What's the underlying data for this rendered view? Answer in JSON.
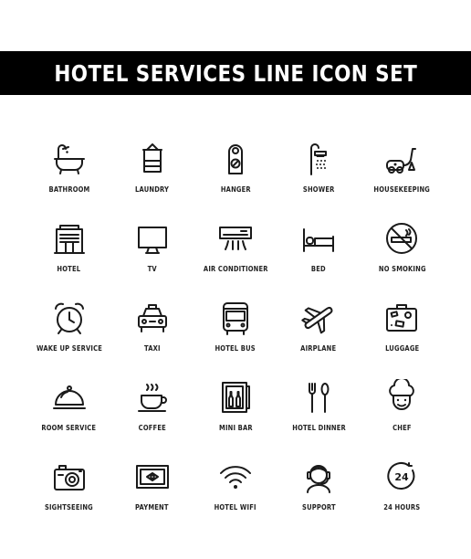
{
  "title": "HOTEL SERVICES LINE ICON SET",
  "icons": [
    {
      "label": "BATHROOM",
      "icon": "bathtub-icon"
    },
    {
      "label": "LAUNDRY",
      "icon": "towel-icon"
    },
    {
      "label": "HANGER",
      "icon": "door-hanger-icon"
    },
    {
      "label": "SHOWER",
      "icon": "shower-icon"
    },
    {
      "label": "HOUSEKEEPING",
      "icon": "vacuum-icon"
    },
    {
      "label": "HOTEL",
      "icon": "hotel-building-icon"
    },
    {
      "label": "TV",
      "icon": "tv-icon"
    },
    {
      "label": "AIR CONDITIONER",
      "icon": "air-conditioner-icon"
    },
    {
      "label": "BED",
      "icon": "bed-icon"
    },
    {
      "label": "NO SMOKING",
      "icon": "no-smoking-icon"
    },
    {
      "label": "WAKE UP SERVICE",
      "icon": "alarm-clock-icon"
    },
    {
      "label": "TAXI",
      "icon": "taxi-icon"
    },
    {
      "label": "HOTEL BUS",
      "icon": "bus-icon"
    },
    {
      "label": "AIRPLANE",
      "icon": "airplane-icon"
    },
    {
      "label": "LUGGAGE",
      "icon": "luggage-icon"
    },
    {
      "label": "ROOM SERVICE",
      "icon": "cloche-icon"
    },
    {
      "label": "COFFEE",
      "icon": "coffee-cup-icon"
    },
    {
      "label": "MINI BAR",
      "icon": "minibar-icon"
    },
    {
      "label": "HOTEL DINNER",
      "icon": "fork-spoon-icon"
    },
    {
      "label": "CHEF",
      "icon": "chef-hat-icon"
    },
    {
      "label": "SIGHTSEEING",
      "icon": "camera-icon"
    },
    {
      "label": "PAYMENT",
      "icon": "banknote-icon"
    },
    {
      "label": "HOTEL WIFI",
      "icon": "wifi-icon"
    },
    {
      "label": "SUPPORT",
      "icon": "headset-operator-icon"
    },
    {
      "label": "24 HOURS",
      "icon": "24-hours-icon"
    }
  ],
  "icon_24_text": "24"
}
